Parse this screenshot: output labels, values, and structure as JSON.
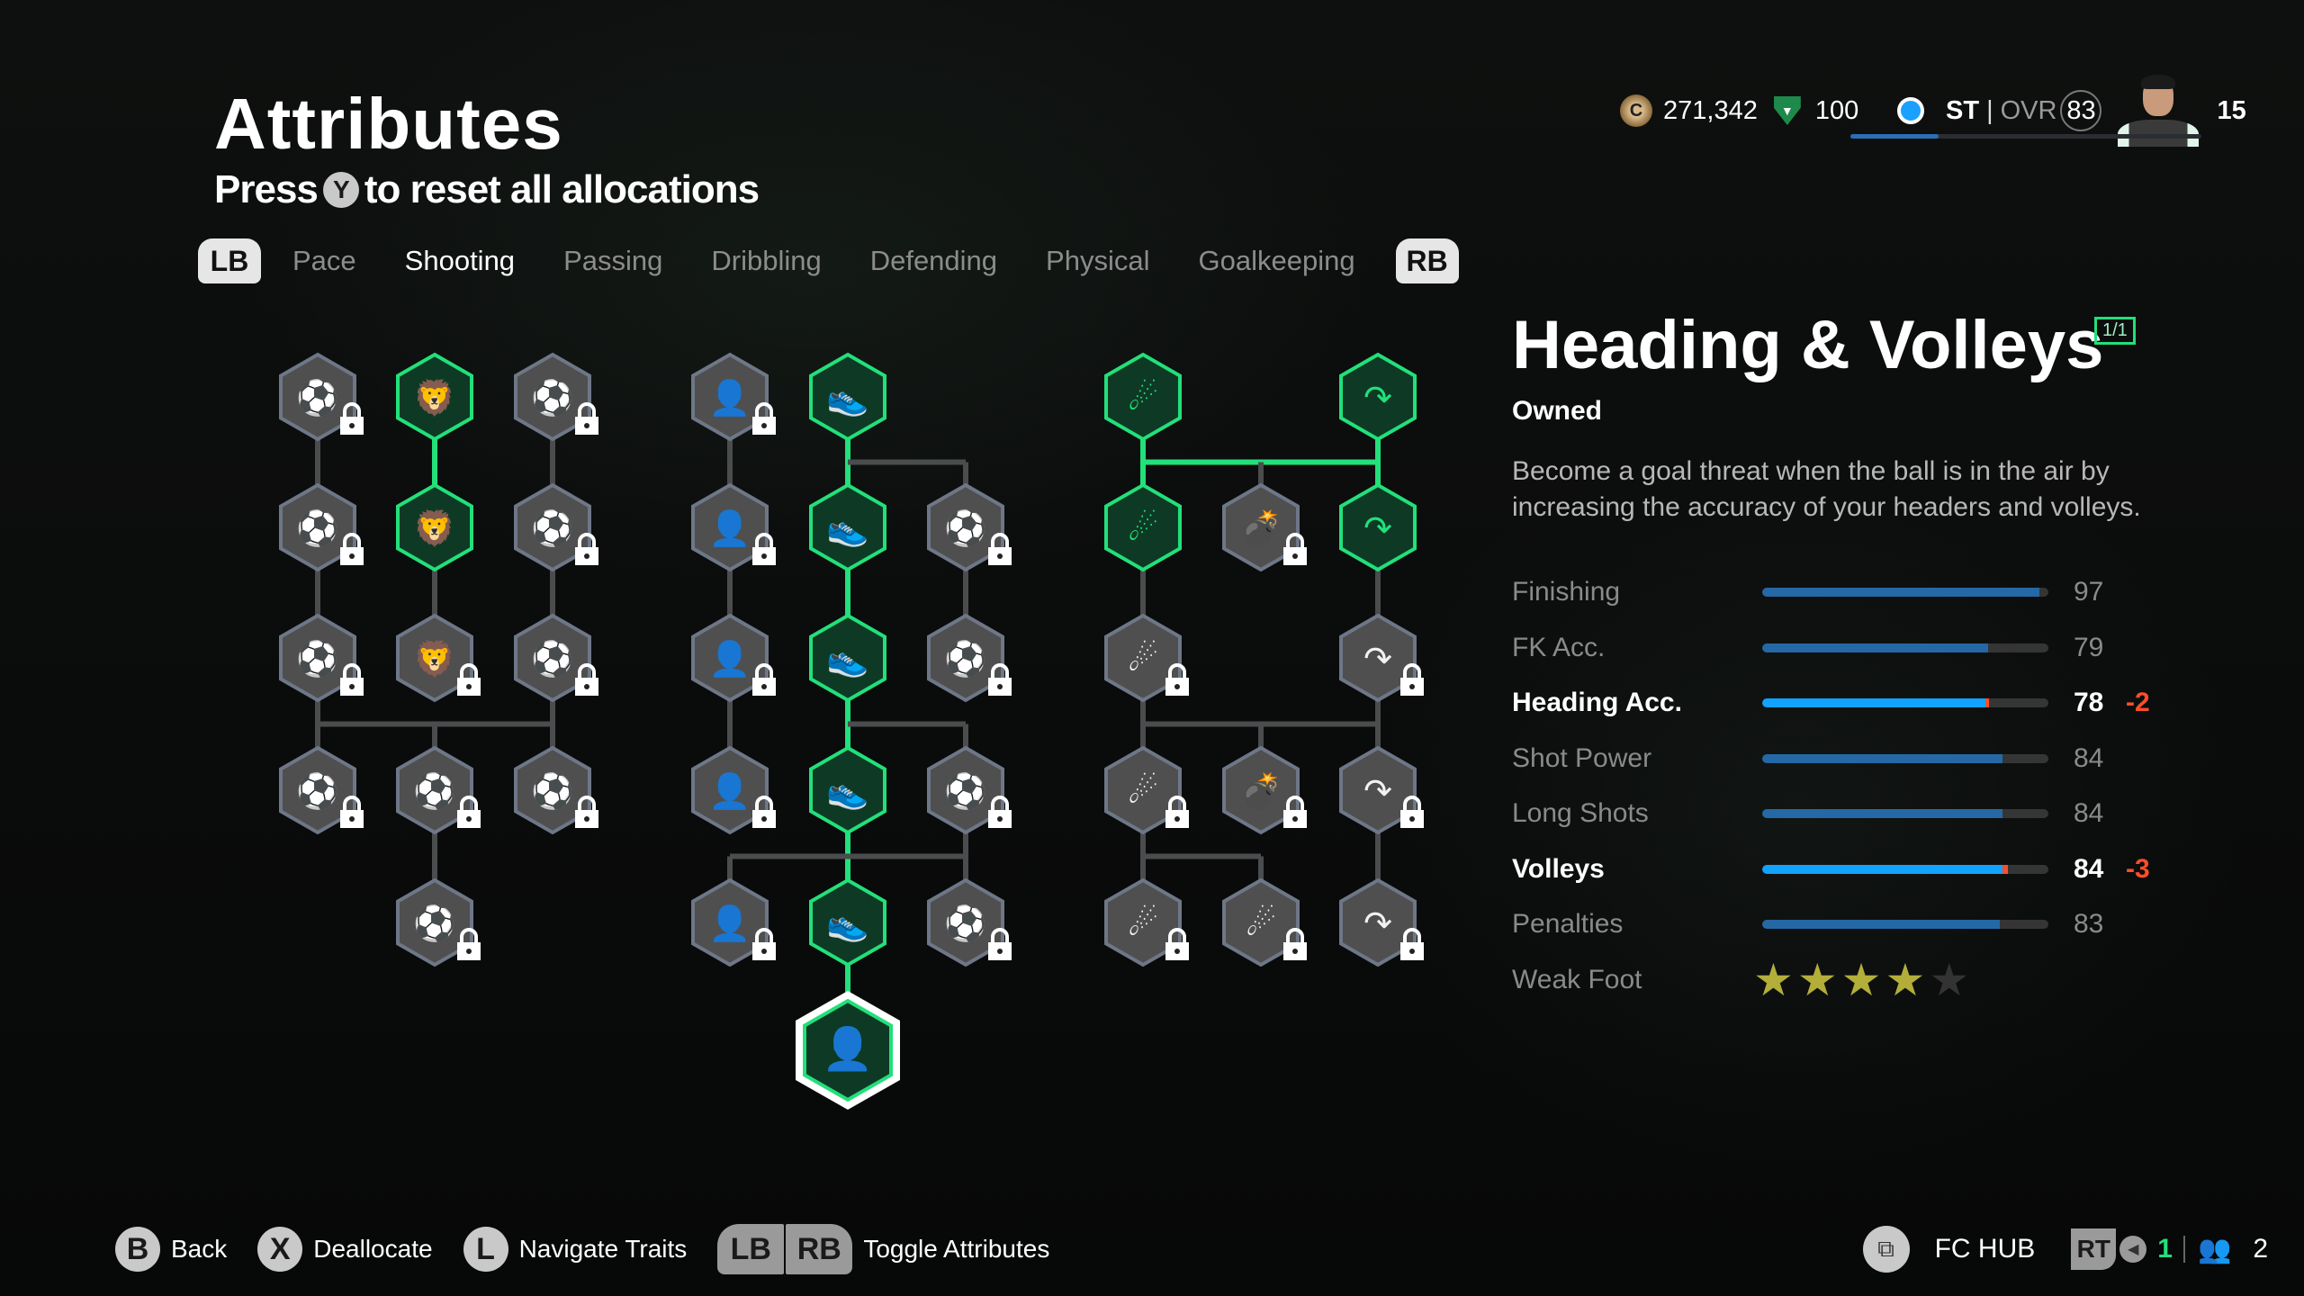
{
  "header": {
    "title": "Attributes",
    "subtitle_prefix": "Press",
    "subtitle_button": "Y",
    "subtitle_suffix": "to reset all allocations"
  },
  "tabs": {
    "left_bumper": "LB",
    "right_bumper": "RB",
    "items": [
      {
        "label": "Pace",
        "active": false
      },
      {
        "label": "Shooting",
        "active": true
      },
      {
        "label": "Passing",
        "active": false
      },
      {
        "label": "Dribbling",
        "active": false
      },
      {
        "label": "Defending",
        "active": false
      },
      {
        "label": "Physical",
        "active": false
      },
      {
        "label": "Goalkeeping",
        "active": false
      }
    ]
  },
  "topbar": {
    "coins_icon": "coin-icon",
    "coins": "271,342",
    "points_icon": "fc-points-icon",
    "points": "100",
    "position": "ST",
    "separator": "|",
    "ovr_label": "OVR",
    "ovr": "83",
    "level": "15",
    "level_progress": 0.25
  },
  "detail": {
    "title": "Heading & Volleys",
    "badge": "1/1",
    "status": "Owned",
    "description": "Become a goal threat when the ball is in the air by increasing the accuracy of your headers and volleys.",
    "stats": [
      {
        "label": "Finishing",
        "value": "97",
        "delta": "",
        "highlight": false
      },
      {
        "label": "FK Acc.",
        "value": "79",
        "delta": "",
        "highlight": false
      },
      {
        "label": "Heading Acc.",
        "value": "78",
        "delta": "-2",
        "highlight": true
      },
      {
        "label": "Shot Power",
        "value": "84",
        "delta": "",
        "highlight": false
      },
      {
        "label": "Long Shots",
        "value": "84",
        "delta": "",
        "highlight": false
      },
      {
        "label": "Volleys",
        "value": "84",
        "delta": "-3",
        "highlight": true
      },
      {
        "label": "Penalties",
        "value": "83",
        "delta": "",
        "highlight": false
      }
    ],
    "weak_foot": {
      "label": "Weak Foot",
      "stars": 4,
      "max": 5
    }
  },
  "tree": {
    "nodes": [
      {
        "id": "g1a1",
        "group": 1,
        "col": 0,
        "row": 0,
        "icon": "outside-foot-icon",
        "owned": false,
        "locked": true
      },
      {
        "id": "g1a2",
        "group": 1,
        "col": 0,
        "row": 1,
        "icon": "outside-foot-icon",
        "owned": false,
        "locked": true
      },
      {
        "id": "g1a3",
        "group": 1,
        "col": 0,
        "row": 2,
        "icon": "outside-foot-icon",
        "owned": false,
        "locked": true
      },
      {
        "id": "g1a4",
        "group": 1,
        "col": 0,
        "row": 3,
        "icon": "outside-foot-icon",
        "owned": false,
        "locked": true
      },
      {
        "id": "g1b1",
        "group": 1,
        "col": 1,
        "row": 0,
        "icon": "lion-icon",
        "owned": true,
        "locked": false
      },
      {
        "id": "g1b2",
        "group": 1,
        "col": 1,
        "row": 1,
        "icon": "lion-icon",
        "owned": true,
        "locked": false
      },
      {
        "id": "g1b3",
        "group": 1,
        "col": 1,
        "row": 2,
        "icon": "lion-icon",
        "owned": false,
        "locked": true
      },
      {
        "id": "g1b4",
        "group": 1,
        "col": 1,
        "row": 3,
        "icon": "outside-foot-icon",
        "owned": false,
        "locked": true
      },
      {
        "id": "g1b5",
        "group": 1,
        "col": 1,
        "row": 4,
        "icon": "outside-foot-icon",
        "owned": false,
        "locked": true
      },
      {
        "id": "g1c1",
        "group": 1,
        "col": 2,
        "row": 0,
        "icon": "penalty-spot-icon",
        "owned": false,
        "locked": true
      },
      {
        "id": "g1c2",
        "group": 1,
        "col": 2,
        "row": 1,
        "icon": "penalty-spot-icon",
        "owned": false,
        "locked": true
      },
      {
        "id": "g1c3",
        "group": 1,
        "col": 2,
        "row": 2,
        "icon": "penalty-spot-icon",
        "owned": false,
        "locked": true
      },
      {
        "id": "g1c4",
        "group": 1,
        "col": 2,
        "row": 3,
        "icon": "penalty-spot-icon",
        "owned": false,
        "locked": true
      },
      {
        "id": "g2a1",
        "group": 2,
        "col": 0,
        "row": 0,
        "icon": "header-icon",
        "owned": false,
        "locked": true
      },
      {
        "id": "g2a2",
        "group": 2,
        "col": 0,
        "row": 1,
        "icon": "header-icon",
        "owned": false,
        "locked": true
      },
      {
        "id": "g2a3",
        "group": 2,
        "col": 0,
        "row": 2,
        "icon": "header-icon",
        "owned": false,
        "locked": true
      },
      {
        "id": "g2a4",
        "group": 2,
        "col": 0,
        "row": 3,
        "icon": "header-icon",
        "owned": false,
        "locked": true
      },
      {
        "id": "g2a5",
        "group": 2,
        "col": 0,
        "row": 4,
        "icon": "header-icon",
        "owned": false,
        "locked": true
      },
      {
        "id": "g2b1",
        "group": 2,
        "col": 1,
        "row": 0,
        "icon": "boot-ball-icon",
        "owned": true,
        "locked": false
      },
      {
        "id": "g2b2",
        "group": 2,
        "col": 1,
        "row": 1,
        "icon": "boot-ball-icon",
        "owned": true,
        "locked": false
      },
      {
        "id": "g2b3",
        "group": 2,
        "col": 1,
        "row": 2,
        "icon": "boot-ball-icon",
        "owned": true,
        "locked": false
      },
      {
        "id": "g2b4",
        "group": 2,
        "col": 1,
        "row": 3,
        "icon": "boot-ball-icon",
        "owned": true,
        "locked": false
      },
      {
        "id": "g2b5",
        "group": 2,
        "col": 1,
        "row": 4,
        "icon": "boot-ball-icon",
        "owned": true,
        "locked": false
      },
      {
        "id": "g2b6",
        "group": 2,
        "col": 1,
        "row": 5,
        "icon": "header-icon",
        "owned": true,
        "locked": false,
        "selected": true
      },
      {
        "id": "g2c2",
        "group": 2,
        "col": 2,
        "row": 1,
        "icon": "volley-icon",
        "owned": false,
        "locked": true
      },
      {
        "id": "g2c3",
        "group": 2,
        "col": 2,
        "row": 2,
        "icon": "volley-icon",
        "owned": false,
        "locked": true
      },
      {
        "id": "g2c4",
        "group": 2,
        "col": 2,
        "row": 3,
        "icon": "volley-icon",
        "owned": false,
        "locked": true
      },
      {
        "id": "g2c5",
        "group": 2,
        "col": 2,
        "row": 4,
        "icon": "volley-icon",
        "owned": false,
        "locked": true
      },
      {
        "id": "g3a1",
        "group": 3,
        "col": 0,
        "row": 0,
        "icon": "power-shot-icon",
        "owned": true,
        "locked": false
      },
      {
        "id": "g3a2",
        "group": 3,
        "col": 0,
        "row": 1,
        "icon": "power-shot-icon",
        "owned": true,
        "locked": false
      },
      {
        "id": "g3a3",
        "group": 3,
        "col": 0,
        "row": 2,
        "icon": "power-shot-icon",
        "owned": false,
        "locked": true
      },
      {
        "id": "g3a4",
        "group": 3,
        "col": 0,
        "row": 3,
        "icon": "power-shot-icon",
        "owned": false,
        "locked": true
      },
      {
        "id": "g3a5",
        "group": 3,
        "col": 0,
        "row": 4,
        "icon": "power-shot-icon",
        "owned": false,
        "locked": true
      },
      {
        "id": "g3b2",
        "group": 3,
        "col": 1,
        "row": 1,
        "icon": "cannon-icon",
        "owned": false,
        "locked": true
      },
      {
        "id": "g3b4",
        "group": 3,
        "col": 1,
        "row": 3,
        "icon": "cannon-icon",
        "owned": false,
        "locked": true
      },
      {
        "id": "g3b5",
        "group": 3,
        "col": 1,
        "row": 4,
        "icon": "power-shot-icon",
        "owned": false,
        "locked": true
      },
      {
        "id": "g3c1",
        "group": 3,
        "col": 2,
        "row": 0,
        "icon": "finesse-shot-icon",
        "owned": true,
        "locked": false
      },
      {
        "id": "g3c2",
        "group": 3,
        "col": 2,
        "row": 1,
        "icon": "finesse-shot-icon",
        "owned": true,
        "locked": false
      },
      {
        "id": "g3c3",
        "group": 3,
        "col": 2,
        "row": 2,
        "icon": "finesse-shot-icon",
        "owned": false,
        "locked": true
      },
      {
        "id": "g3c4",
        "group": 3,
        "col": 2,
        "row": 3,
        "icon": "finesse-shot-icon",
        "owned": false,
        "locked": true
      },
      {
        "id": "g3c5",
        "group": 3,
        "col": 2,
        "row": 4,
        "icon": "finesse-shot-icon",
        "owned": false,
        "locked": true
      }
    ],
    "links": [
      {
        "from": "g1a1",
        "to": "g1a2",
        "active": false
      },
      {
        "from": "g1a2",
        "to": "g1a3",
        "active": false
      },
      {
        "from": "g1b1",
        "to": "g1b2",
        "active": true
      },
      {
        "from": "g1b2",
        "to": "g1b3",
        "active": false
      },
      {
        "from": "g1c1",
        "to": "g1c2",
        "active": false
      },
      {
        "from": "g1c2",
        "to": "g1c3",
        "active": false
      },
      {
        "bus": true,
        "group": 1,
        "row": 2.5,
        "fromCol": 0,
        "toCol": 2,
        "drops": [
          0,
          1,
          2
        ],
        "rises": [
          0,
          2
        ],
        "active": false
      },
      {
        "from": "g1b4",
        "to": "g1b5",
        "active": false
      },
      {
        "from": "g2a1",
        "to": "g2a2",
        "active": false
      },
      {
        "from": "g2a2",
        "to": "g2a3",
        "active": false
      },
      {
        "from": "g2a3",
        "to": "g2a4",
        "active": false
      },
      {
        "from": "g2b1",
        "to": "g2b2",
        "active": true
      },
      {
        "from": "g2b2",
        "to": "g2b3",
        "active": true
      },
      {
        "from": "g2b3",
        "to": "g2b4",
        "active": true
      },
      {
        "from": "g2b4",
        "to": "g2b5",
        "active": true
      },
      {
        "from": "g2b5",
        "to": "g2b6",
        "active": true
      },
      {
        "bus": true,
        "group": 2,
        "row": 0.5,
        "fromCol": 1,
        "toCol": 2,
        "drops": [
          2
        ],
        "rises": [],
        "active": false
      },
      {
        "from": "g2c2",
        "to": "g2c3",
        "active": false
      },
      {
        "bus": true,
        "group": 2,
        "row": 2.5,
        "fromCol": 1,
        "toCol": 2,
        "drops": [
          2
        ],
        "rises": [],
        "active": false
      },
      {
        "from": "g2c4",
        "to": "g2c5",
        "active": false
      },
      {
        "bus": true,
        "group": 2,
        "row": 3.5,
        "fromCol": 0,
        "toCol": 2,
        "drops": [
          0,
          2
        ],
        "rises": [],
        "active": false
      },
      {
        "from": "g3a1",
        "to": "g3a2",
        "active": true
      },
      {
        "from": "g3c1",
        "to": "g3c2",
        "active": true
      },
      {
        "bus": true,
        "group": 3,
        "row": 0.5,
        "fromCol": 0,
        "toCol": 2,
        "drops": [
          1
        ],
        "rises": [],
        "active": true
      },
      {
        "from": "g3a2",
        "to": "g3a3",
        "active": false
      },
      {
        "from": "g3c2",
        "to": "g3c3",
        "active": false
      },
      {
        "bus": true,
        "group": 3,
        "row": 2.5,
        "fromCol": 0,
        "toCol": 2,
        "drops": [
          0,
          1,
          2
        ],
        "rises": [
          0,
          2
        ],
        "active": false
      },
      {
        "from": "g3c4",
        "to": "g3c5",
        "active": false
      },
      {
        "bus": true,
        "group": 3,
        "row": 3.5,
        "fromCol": 0,
        "toCol": 1,
        "drops": [
          0,
          1
        ],
        "rises": [
          0
        ],
        "active": false
      }
    ]
  },
  "footer": {
    "actions": [
      {
        "button": "B",
        "label": "Back"
      },
      {
        "button": "X",
        "label": "Deallocate"
      },
      {
        "button": "L",
        "label": "Navigate Traits"
      }
    ],
    "toggle": {
      "lb": "LB",
      "rb": "RB",
      "label": "Toggle Attributes"
    },
    "hub": {
      "icon": "fc-hub-icon",
      "label": "FC HUB"
    },
    "rt": "RT",
    "mic_count": "1",
    "party_count": "2"
  },
  "colors": {
    "accent_green": "#22e07a",
    "owned_fill": "#0e3a25",
    "locked_fill": "#4f4f4f",
    "locked_border": "#6e7787",
    "stat_bar": "#2568a6",
    "stat_bar_highlight": "#12a3ff",
    "negative_delta": "#ff4d2a",
    "star": "#b3ae3a"
  }
}
